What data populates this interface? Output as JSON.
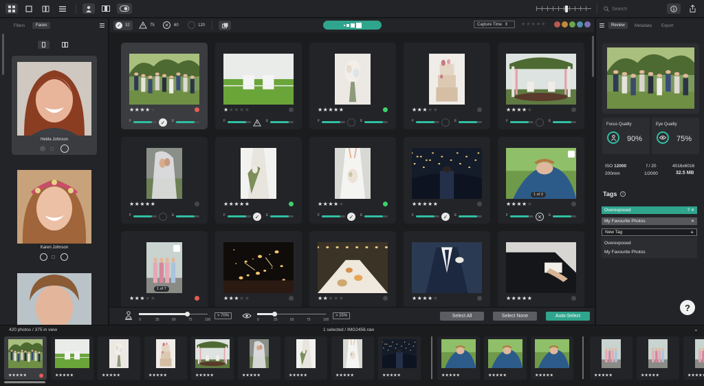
{
  "toolbar": {
    "search_placeholder": "Search",
    "zoom_value": 0.55
  },
  "filter_bar": {
    "accepted_count": "32",
    "warning_count": "75",
    "rejected_count": "60",
    "unrated_count": "120",
    "sort_label": "Capture Time",
    "color_labels": [
      "#b55a4f",
      "#bf8b3a",
      "#6fa44f",
      "#4f8fb0",
      "#7a72b3"
    ]
  },
  "left_panel": {
    "tab_filters": "Filters",
    "tab_faces": "Faces",
    "faces": [
      {
        "name": "Helda Johnson"
      },
      {
        "name": "Karen Johnson"
      },
      {
        "name": ""
      }
    ]
  },
  "grid": {
    "cards": [
      {
        "stars": 4,
        "label": "red",
        "mark": "ok",
        "selected": true,
        "photo": "group-photo",
        "aspect": "land"
      },
      {
        "stars": 1,
        "label": "none",
        "mark": "warn",
        "photo": "lawn-chairs",
        "aspect": "land"
      },
      {
        "stars": 5,
        "label": "green",
        "mark": "none",
        "photo": "bouquet",
        "aspect": "port"
      },
      {
        "stars": 3,
        "label": "none",
        "mark": "none",
        "photo": "wedding-cake",
        "aspect": "port"
      },
      {
        "stars": 4,
        "label": "none",
        "mark": "none",
        "photo": "gazebo",
        "aspect": "land"
      },
      {
        "stars": 5,
        "label": "none",
        "mark": "none",
        "photo": "bride-veil",
        "aspect": "port"
      },
      {
        "stars": 5,
        "label": "green",
        "mark": "ok",
        "photo": "bride-bouquet",
        "aspect": "port"
      },
      {
        "stars": 4,
        "label": "green",
        "mark": "ok",
        "photo": "bride-dress",
        "aspect": "port"
      },
      {
        "stars": 5,
        "label": "none",
        "mark": "ok",
        "photo": "evening-party",
        "aspect": "land"
      },
      {
        "stars": 4,
        "label": "none",
        "mark": "x",
        "photo": "couple-closeup",
        "aspect": "land",
        "stack": "1 of 3"
      },
      {
        "stars": 3,
        "label": "red",
        "mark": "none",
        "photo": "bridesmaids",
        "aspect": "port",
        "stack": "1 of 7"
      },
      {
        "stars": 3,
        "label": "none",
        "mark": "none",
        "photo": "sparklers",
        "aspect": "land"
      },
      {
        "stars": 2,
        "label": "none",
        "mark": "none",
        "photo": "banquet-table",
        "aspect": "land"
      },
      {
        "stars": 4,
        "label": "none",
        "mark": "none",
        "photo": "groom-suit",
        "aspect": "land"
      },
      {
        "stars": 5,
        "label": "none",
        "mark": "none",
        "photo": "groom-cufflinks",
        "aspect": "land"
      }
    ]
  },
  "bottom_bar": {
    "focus_threshold": "> 70%",
    "eye_threshold": "> 25%",
    "focus_slider_value": 0.7,
    "eye_slider_value": 0.25,
    "slider_ticks": [
      "0",
      "25",
      "50",
      "75",
      "100"
    ],
    "select_all": "Select All",
    "select_none": "Select None",
    "auto_select": "Auto-Select"
  },
  "right_panel": {
    "tab_review": "Review",
    "tab_metadata": "Metadata",
    "tab_export": "Export",
    "focus_quality_label": "Focus Quality",
    "focus_quality_value": "90%",
    "eye_quality_label": "Eye Quality",
    "eye_quality_value": "75%",
    "iso_label": "ISO",
    "iso_value": "12000",
    "aperture": "f / 20",
    "resolution": "4016x6016",
    "focal_length": "200mm",
    "shutter": "1/2000",
    "file_size": "32.5 MB",
    "tags_title": "Tags",
    "tags": [
      "Overexposed",
      "My Favourite Photos"
    ],
    "new_tag_value": "New Tag",
    "suggestions": [
      "Overexposed",
      "My Favourite Photos"
    ]
  },
  "filmstrip": {
    "count_text": "420 photos / 375 in view",
    "selection_text": "1 selected / IMG2456.raw",
    "items": [
      {
        "stars": 4,
        "photo": "group-photo",
        "label": "red",
        "selected": true
      },
      {
        "stars": 1,
        "photo": "lawn-chairs"
      },
      {
        "stars": 5,
        "photo": "bouquet"
      },
      {
        "stars": 3,
        "photo": "wedding-cake"
      },
      {
        "stars": 4,
        "photo": "gazebo"
      },
      {
        "stars": 5,
        "photo": "bride-veil"
      },
      {
        "stars": 4,
        "photo": "bride-bouquet"
      },
      {
        "stars": 4,
        "photo": "bride-dress"
      },
      {
        "stars": 5,
        "photo": "evening-party"
      },
      {
        "stars": 5,
        "photo": "couple-closeup"
      },
      {
        "stars": 4,
        "photo": "couple-closeup"
      },
      {
        "stars": 2,
        "photo": "couple-closeup"
      },
      {
        "stars": 3,
        "photo": "bridesmaids"
      },
      {
        "stars": 4,
        "photo": "bridesmaids"
      },
      {
        "stars": 3,
        "photo": "bridesmaids"
      }
    ]
  },
  "help_label": "?"
}
